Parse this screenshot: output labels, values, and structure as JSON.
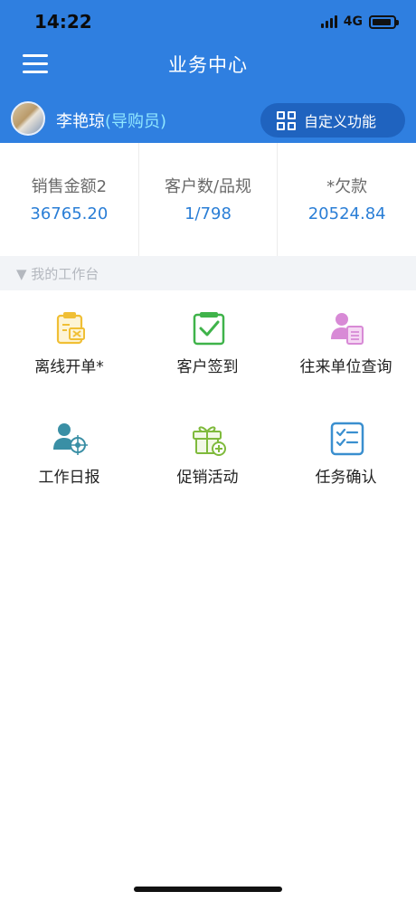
{
  "status_bar": {
    "time": "14:22",
    "network": "4G"
  },
  "nav": {
    "title": "业务中心"
  },
  "user": {
    "name": "李艳琼",
    "role": "(导购员)"
  },
  "custom_func": {
    "label": "自定义功能"
  },
  "stats": [
    {
      "label": "销售金额2",
      "value": "36765.20"
    },
    {
      "label": "客户数/品规",
      "value": "1/798"
    },
    {
      "label": "*欠款",
      "value": "20524.84"
    }
  ],
  "section": {
    "title": "▼ 我的工作台"
  },
  "features": [
    {
      "label": "离线开单*",
      "icon": "offline-order-icon"
    },
    {
      "label": "客户签到",
      "icon": "customer-checkin-icon"
    },
    {
      "label": "往来单位查询",
      "icon": "contacts-query-icon"
    },
    {
      "label": "工作日报",
      "icon": "work-report-icon"
    },
    {
      "label": "促销活动",
      "icon": "promotion-gift-icon"
    },
    {
      "label": "任务确认",
      "icon": "task-confirm-icon"
    }
  ],
  "colors": {
    "header": "#2f7fe0",
    "accent": "#2a7ed6",
    "role": "#8fe6ff"
  }
}
